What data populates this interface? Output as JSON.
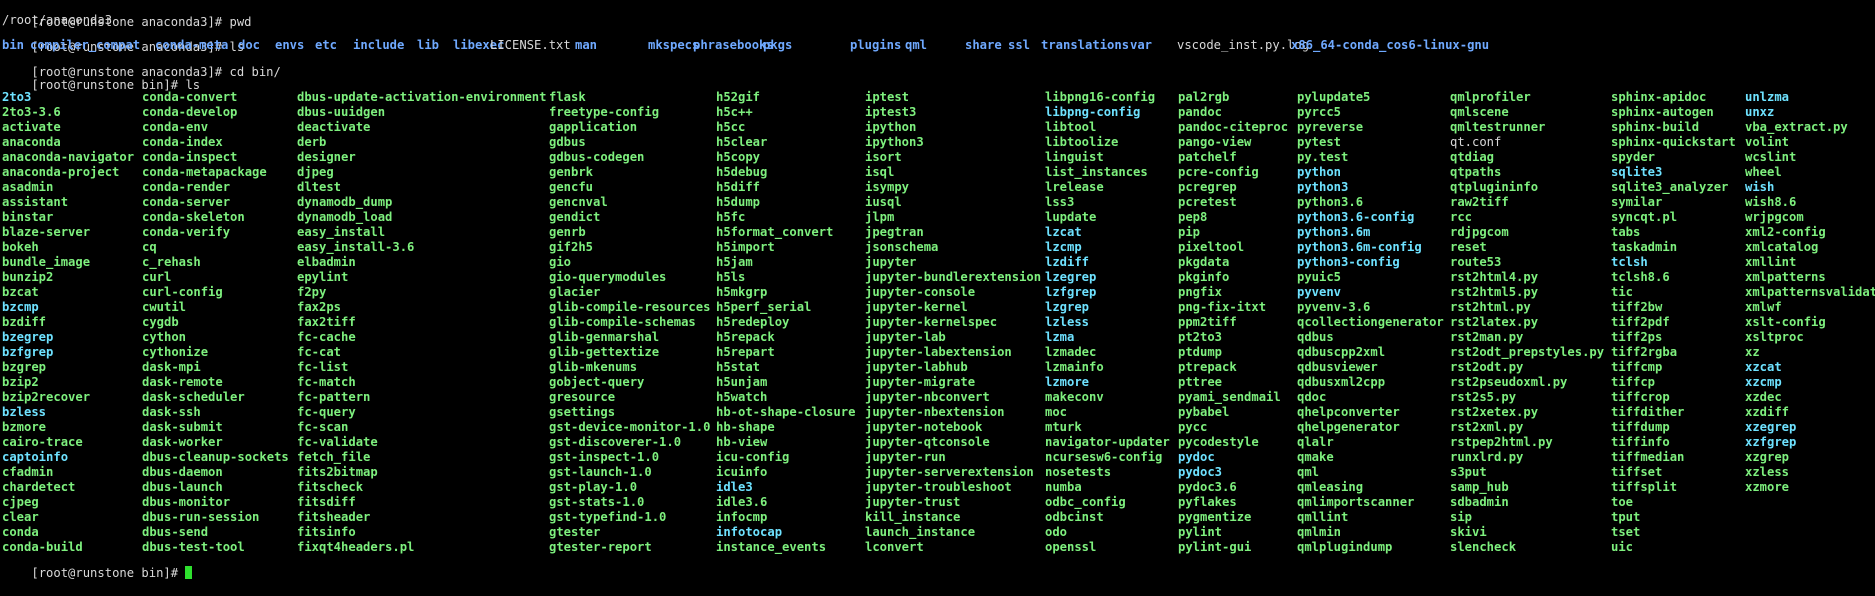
{
  "colors": {
    "background": "#000000",
    "text": "#d8d8d8",
    "directory": "#6fa9ff",
    "executable": "#7ef07e",
    "symlink": "#6ee2ff",
    "cursor": "#2ee02e"
  },
  "prompt_anaconda": "[root@runstone anaconda3]# ",
  "prompt_bin": "[root@runstone bin]# ",
  "cmd_pwd": "pwd",
  "pwd_output": "/root/anaconda3",
  "cmd_ls": "ls",
  "cmd_cd": "cd bin/",
  "ls_root": [
    {
      "name": "bin",
      "kind": "dir"
    },
    {
      "name": "compiler_compat",
      "kind": "dir"
    },
    {
      "name": "conda-meta",
      "kind": "dir"
    },
    {
      "name": "doc",
      "kind": "dir"
    },
    {
      "name": "envs",
      "kind": "dir"
    },
    {
      "name": "etc",
      "kind": "dir"
    },
    {
      "name": "include",
      "kind": "dir"
    },
    {
      "name": "lib",
      "kind": "dir"
    },
    {
      "name": "libexec",
      "kind": "dir"
    },
    {
      "name": "LICENSE.txt",
      "kind": "file"
    },
    {
      "name": "man",
      "kind": "dir"
    },
    {
      "name": "mkspecs",
      "kind": "dir"
    },
    {
      "name": "phrasebooks",
      "kind": "dir"
    },
    {
      "name": "pkgs",
      "kind": "dir"
    },
    {
      "name": "plugins",
      "kind": "dir"
    },
    {
      "name": "qml",
      "kind": "dir"
    },
    {
      "name": "share",
      "kind": "dir"
    },
    {
      "name": "ssl",
      "kind": "dir"
    },
    {
      "name": "translations",
      "kind": "dir"
    },
    {
      "name": "var",
      "kind": "dir"
    },
    {
      "name": "vscode_inst.py.log",
      "kind": "file"
    },
    {
      "name": "x86_64-conda_cos6-linux-gnu",
      "kind": "dir"
    }
  ],
  "ls_bin_columns": [
    [
      "2to3",
      "2to3-3.6",
      "activate",
      "anaconda",
      "anaconda-navigator",
      "anaconda-project",
      "asadmin",
      "assistant",
      "binstar",
      "blaze-server",
      "bokeh",
      "bundle_image",
      "bunzip2",
      "bzcat",
      "bzcmp",
      "bzdiff",
      "bzegrep",
      "bzfgrep",
      "bzgrep",
      "bzip2",
      "bzip2recover",
      "bzless",
      "bzmore",
      "cairo-trace",
      "captoinfo",
      "cfadmin",
      "chardetect",
      "cjpeg",
      "clear",
      "conda",
      "conda-build"
    ],
    [
      "conda-convert",
      "conda-develop",
      "conda-env",
      "conda-index",
      "conda-inspect",
      "conda-metapackage",
      "conda-render",
      "conda-server",
      "conda-skeleton",
      "conda-verify",
      "cq",
      "c_rehash",
      "curl",
      "curl-config",
      "cwutil",
      "cygdb",
      "cython",
      "cythonize",
      "dask-mpi",
      "dask-remote",
      "dask-scheduler",
      "dask-ssh",
      "dask-submit",
      "dask-worker",
      "dbus-cleanup-sockets",
      "dbus-daemon",
      "dbus-launch",
      "dbus-monitor",
      "dbus-run-session",
      "dbus-send",
      "dbus-test-tool"
    ],
    [
      "dbus-update-activation-environment",
      "dbus-uuidgen",
      "deactivate",
      "derb",
      "designer",
      "djpeg",
      "dltest",
      "dynamodb_dump",
      "dynamodb_load",
      "easy_install",
      "easy_install-3.6",
      "elbadmin",
      "epylint",
      "f2py",
      "fax2ps",
      "fax2tiff",
      "fc-cache",
      "fc-cat",
      "fc-list",
      "fc-match",
      "fc-pattern",
      "fc-query",
      "fc-scan",
      "fc-validate",
      "fetch_file",
      "fits2bitmap",
      "fitscheck",
      "fitsdiff",
      "fitsheader",
      "fitsinfo",
      "fixqt4headers.pl"
    ],
    [
      "flask",
      "freetype-config",
      "gapplication",
      "gdbus",
      "gdbus-codegen",
      "genbrk",
      "gencfu",
      "gencnval",
      "gendict",
      "genrb",
      "gif2h5",
      "gio",
      "gio-querymodules",
      "glacier",
      "glib-compile-resources",
      "glib-compile-schemas",
      "glib-genmarshal",
      "glib-gettextize",
      "glib-mkenums",
      "gobject-query",
      "gresource",
      "gsettings",
      "gst-device-monitor-1.0",
      "gst-discoverer-1.0",
      "gst-inspect-1.0",
      "gst-launch-1.0",
      "gst-play-1.0",
      "gst-stats-1.0",
      "gst-typefind-1.0",
      "gtester",
      "gtester-report"
    ],
    [
      "h52gif",
      "h5c++",
      "h5cc",
      "h5clear",
      "h5copy",
      "h5debug",
      "h5diff",
      "h5dump",
      "h5fc",
      "h5format_convert",
      "h5import",
      "h5jam",
      "h5ls",
      "h5mkgrp",
      "h5perf_serial",
      "h5redeploy",
      "h5repack",
      "h5repart",
      "h5stat",
      "h5unjam",
      "h5watch",
      "hb-ot-shape-closure",
      "hb-shape",
      "hb-view",
      "icu-config",
      "icuinfo",
      "idle3",
      "idle3.6",
      "infocmp",
      "infotocap",
      "instance_events"
    ],
    [
      "iptest",
      "iptest3",
      "ipython",
      "ipython3",
      "isort",
      "isql",
      "isympy",
      "iusql",
      "jlpm",
      "jpegtran",
      "jsonschema",
      "jupyter",
      "jupyter-bundlerextension",
      "jupyter-console",
      "jupyter-kernel",
      "jupyter-kernelspec",
      "jupyter-lab",
      "jupyter-labextension",
      "jupyter-labhub",
      "jupyter-migrate",
      "jupyter-nbconvert",
      "jupyter-nbextension",
      "jupyter-notebook",
      "jupyter-qtconsole",
      "jupyter-run",
      "jupyter-serverextension",
      "jupyter-troubleshoot",
      "jupyter-trust",
      "kill_instance",
      "launch_instance",
      "lconvert"
    ],
    [
      "libpng16-config",
      "libpng-config",
      "libtool",
      "libtoolize",
      "linguist",
      "list_instances",
      "lrelease",
      "lss3",
      "lupdate",
      "lzcat",
      "lzcmp",
      "lzdiff",
      "lzegrep",
      "lzfgrep",
      "lzgrep",
      "lzless",
      "lzma",
      "lzmadec",
      "lzmainfo",
      "lzmore",
      "makeconv",
      "moc",
      "mturk",
      "navigator-updater",
      "ncursesw6-config",
      "nosetests",
      "numba",
      "odbc_config",
      "odbcinst",
      "odo",
      "openssl"
    ],
    [
      "pal2rgb",
      "pandoc",
      "pandoc-citeproc",
      "pango-view",
      "patchelf",
      "pcre-config",
      "pcregrep",
      "pcretest",
      "pep8",
      "pip",
      "pixeltool",
      "pkgdata",
      "pkginfo",
      "pngfix",
      "png-fix-itxt",
      "ppm2tiff",
      "pt2to3",
      "ptdump",
      "ptrepack",
      "pttree",
      "pyami_sendmail",
      "pybabel",
      "pycc",
      "pycodestyle",
      "pydoc",
      "pydoc3",
      "pydoc3.6",
      "pyflakes",
      "pygmentize",
      "pylint",
      "pylint-gui"
    ],
    [
      "pylupdate5",
      "pyrcc5",
      "pyreverse",
      "pytest",
      "py.test",
      "python",
      "python3",
      "python3.6",
      "python3.6-config",
      "python3.6m",
      "python3.6m-config",
      "python3-config",
      "pyuic5",
      "pyvenv",
      "pyvenv-3.6",
      "qcollectiongenerator",
      "qdbus",
      "qdbuscpp2xml",
      "qdbusviewer",
      "qdbusxml2cpp",
      "qdoc",
      "qhelpconverter",
      "qhelpgenerator",
      "qlalr",
      "qmake",
      "qml",
      "qmleasing",
      "qmlimportscanner",
      "qmllint",
      "qmlmin",
      "qmlplugindump"
    ],
    [
      "qmlprofiler",
      "qmlscene",
      "qmltestrunner",
      "qt.conf",
      "qtdiag",
      "qtpaths",
      "qtplugininfo",
      "raw2tiff",
      "rcc",
      "rdjpgcom",
      "reset",
      "route53",
      "rst2html4.py",
      "rst2html5.py",
      "rst2html.py",
      "rst2latex.py",
      "rst2man.py",
      "rst2odt_prepstyles.py",
      "rst2odt.py",
      "rst2pseudoxml.py",
      "rst2s5.py",
      "rst2xetex.py",
      "rst2xml.py",
      "rstpep2html.py",
      "runxlrd.py",
      "s3put",
      "samp_hub",
      "sdbadmin",
      "sip",
      "skivi",
      "slencheck"
    ],
    [
      "sphinx-apidoc",
      "sphinx-autogen",
      "sphinx-build",
      "sphinx-quickstart",
      "spyder",
      "sqlite3",
      "sqlite3_analyzer",
      "symilar",
      "syncqt.pl",
      "tabs",
      "taskadmin",
      "tclsh",
      "tclsh8.6",
      "tic",
      "tiff2bw",
      "tiff2pdf",
      "tiff2ps",
      "tiff2rgba",
      "tiffcmp",
      "tiffcp",
      "tiffcrop",
      "tiffdither",
      "tiffdump",
      "tiffinfo",
      "tiffmedian",
      "tiffset",
      "tiffsplit",
      "toe",
      "tput",
      "tset",
      "uic"
    ],
    [
      "unlzma",
      "unxz",
      "vba_extract.py",
      "volint",
      "wcslint",
      "wheel",
      "wish",
      "wish8.6",
      "wrjpgcom",
      "xml2-config",
      "xmlcatalog",
      "xmllint",
      "xmlpatterns",
      "xmlpatternsvalidator",
      "xmlwf",
      "xslt-config",
      "xsltproc",
      "xz",
      "xzcat",
      "xzcmp",
      "xzdec",
      "xzdiff",
      "xzegrep",
      "xzfgrep",
      "xzgrep",
      "xzless",
      "xzmore"
    ]
  ],
  "ls_bin_symlinks": [
    "2to3",
    "bzcmp",
    "bzegrep",
    "bzfgrep",
    "bzless",
    "captoinfo",
    "libpng-config",
    "lzcat",
    "lzcmp",
    "lzdiff",
    "lzegrep",
    "lzfgrep",
    "lzgrep",
    "lzless",
    "lzma",
    "lzmore",
    "python",
    "python3",
    "python3.6-config",
    "python3.6m",
    "python3.6m-config",
    "python3-config",
    "pyvenv",
    "pydoc",
    "pydoc3",
    "idle3",
    "infotocap",
    "wish",
    "unlzma",
    "unxz",
    "xzcat",
    "xzcmp",
    "xzegrep",
    "xzfgrep",
    "sqlite3",
    "tclsh"
  ],
  "ls_bin_files": [
    "qt.conf"
  ]
}
